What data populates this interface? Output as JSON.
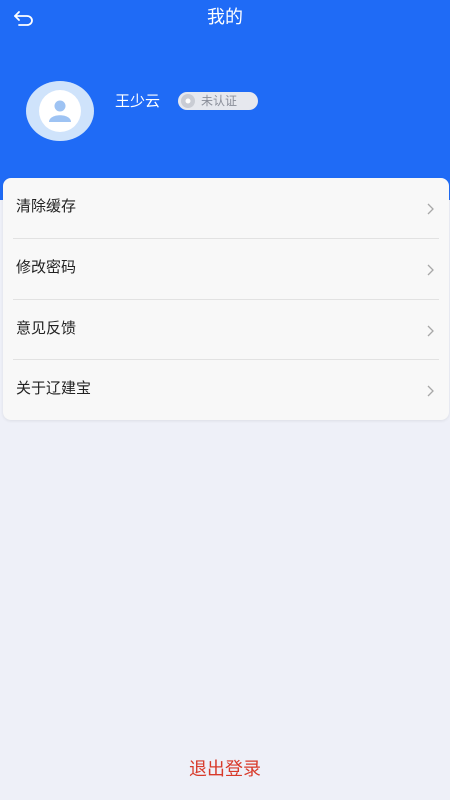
{
  "header": {
    "title": "我的",
    "back_icon": "back-arrow-icon",
    "background": "#1f6bf6"
  },
  "profile": {
    "name": "王少云",
    "badge": "未认证",
    "avatar_icon": "user-avatar-icon"
  },
  "menu": {
    "items": [
      {
        "label": "清除缓存"
      },
      {
        "label": "修改密码"
      },
      {
        "label": "意见反馈"
      },
      {
        "label": "关于辽建宝"
      }
    ]
  },
  "logout": {
    "label": "退出登录",
    "color": "#d83a2a"
  }
}
